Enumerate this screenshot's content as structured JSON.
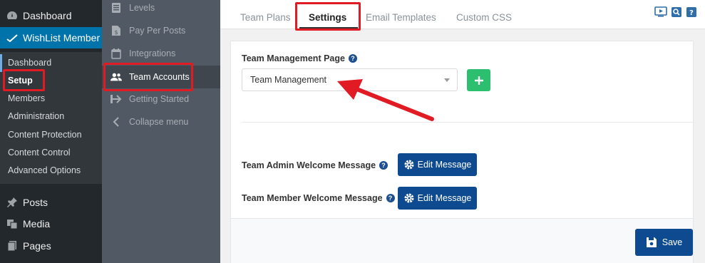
{
  "wp_menu": {
    "dashboard": "Dashboard",
    "wishlist": "WishList Member",
    "posts": "Posts",
    "media": "Media",
    "pages": "Pages",
    "submenu": [
      "Dashboard",
      "Setup",
      "Members",
      "Administration",
      "Content Protection",
      "Content Control",
      "Advanced Options"
    ]
  },
  "wl_nav": {
    "levels": "Levels",
    "pay_per_posts": "Pay Per Posts",
    "integrations": "Integrations",
    "team_accounts": "Team Accounts",
    "getting_started": "Getting Started",
    "collapse": "Collapse menu"
  },
  "tabs": {
    "team_plans": "Team Plans",
    "settings": "Settings",
    "email_templates": "Email Templates",
    "custom_css": "Custom CSS"
  },
  "settings": {
    "team_page_label": "Team Management Page",
    "team_page_value": "Team Management",
    "admin_welcome_label": "Team Admin Welcome Message",
    "member_welcome_label": "Team Member Welcome Message",
    "edit_message": "Edit Message",
    "save": "Save",
    "help_glyph": "?"
  },
  "colors": {
    "wp_sidebar": "#23282d",
    "wp_active": "#0073aa",
    "wl_nav": "#515a64",
    "primary_button": "#0d4a8f",
    "add_button": "#2bbf6f",
    "annotation": "#e01b24"
  },
  "icons": [
    "dashboard-icon",
    "wishlist-icon",
    "pin-icon",
    "media-icon",
    "pages-icon",
    "levels-icon",
    "pay-per-post-icon",
    "integrations-icon",
    "team-icon",
    "getting-started-icon",
    "collapse-icon",
    "video-icon",
    "search-icon",
    "help-doc-icon",
    "gear-icon",
    "save-icon"
  ]
}
